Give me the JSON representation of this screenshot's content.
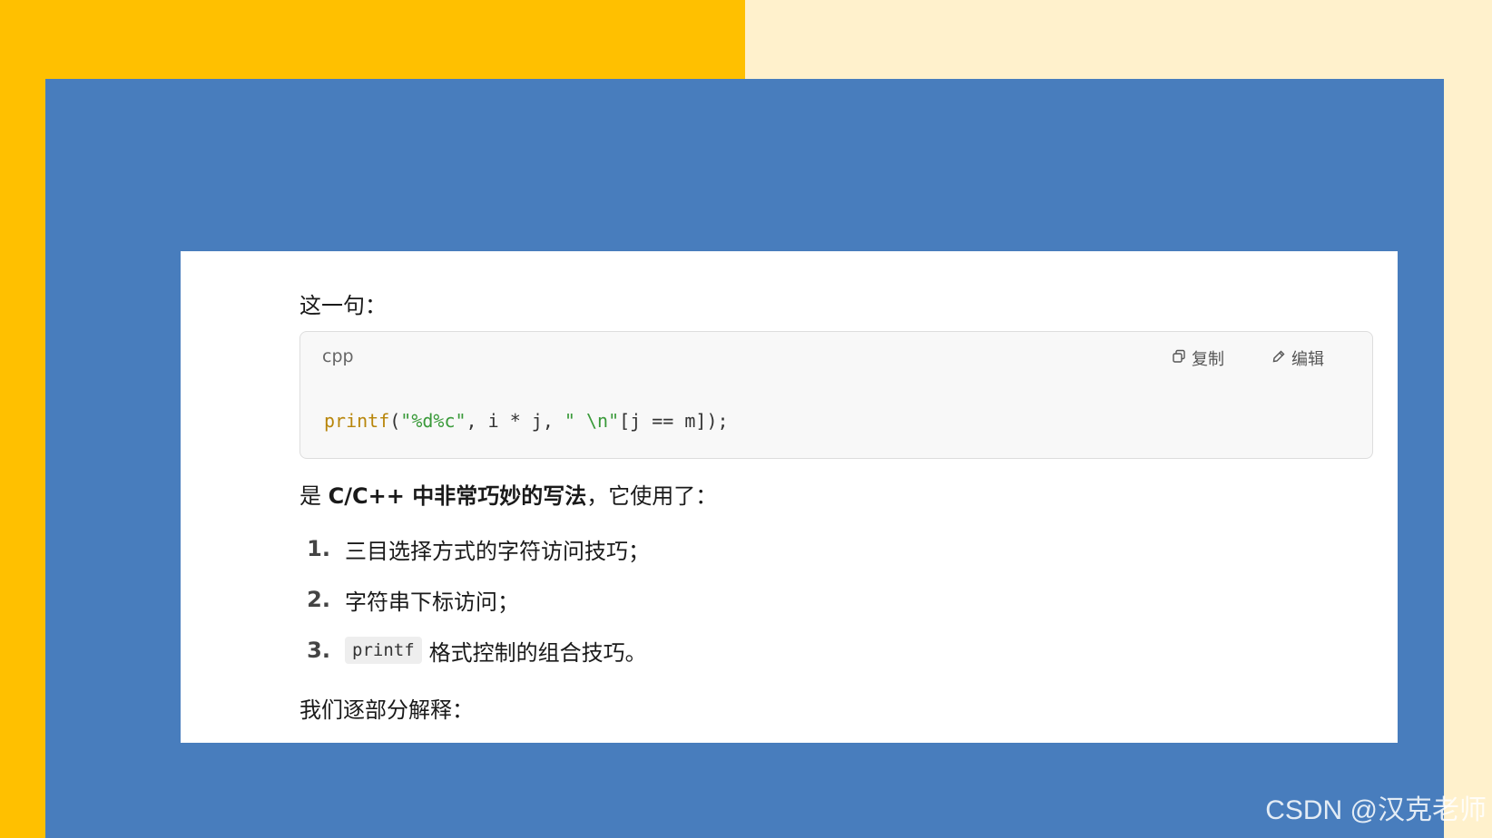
{
  "background": {
    "left_color": "#FFC000",
    "right_color": "#FFF1CC",
    "panel_color": "#487DBD"
  },
  "content": {
    "intro": "这一句：",
    "code_block": {
      "language": "cpp",
      "copy_label": "复制",
      "edit_label": "编辑",
      "copy_icon": "copy-icon",
      "edit_icon": "edit-icon",
      "code": {
        "fn": "printf",
        "open": "(",
        "str1": "\"%d%c\"",
        "mid": ", i * j, ",
        "str2": "\" \\n\"",
        "rest": "[j == m]);"
      }
    },
    "summary": {
      "prefix": "是 ",
      "bold": "C/C++ 中非常巧妙的写法",
      "suffix": "，它使用了："
    },
    "list": [
      {
        "num": "1.",
        "text": "三目选择方式的字符访问技巧；"
      },
      {
        "num": "2.",
        "text": "字符串下标访问；"
      },
      {
        "num": "3.",
        "code": "printf",
        "text": "格式控制的组合技巧。"
      }
    ],
    "outro": "我们逐部分解释："
  },
  "watermark": "CSDN @汉克老师"
}
